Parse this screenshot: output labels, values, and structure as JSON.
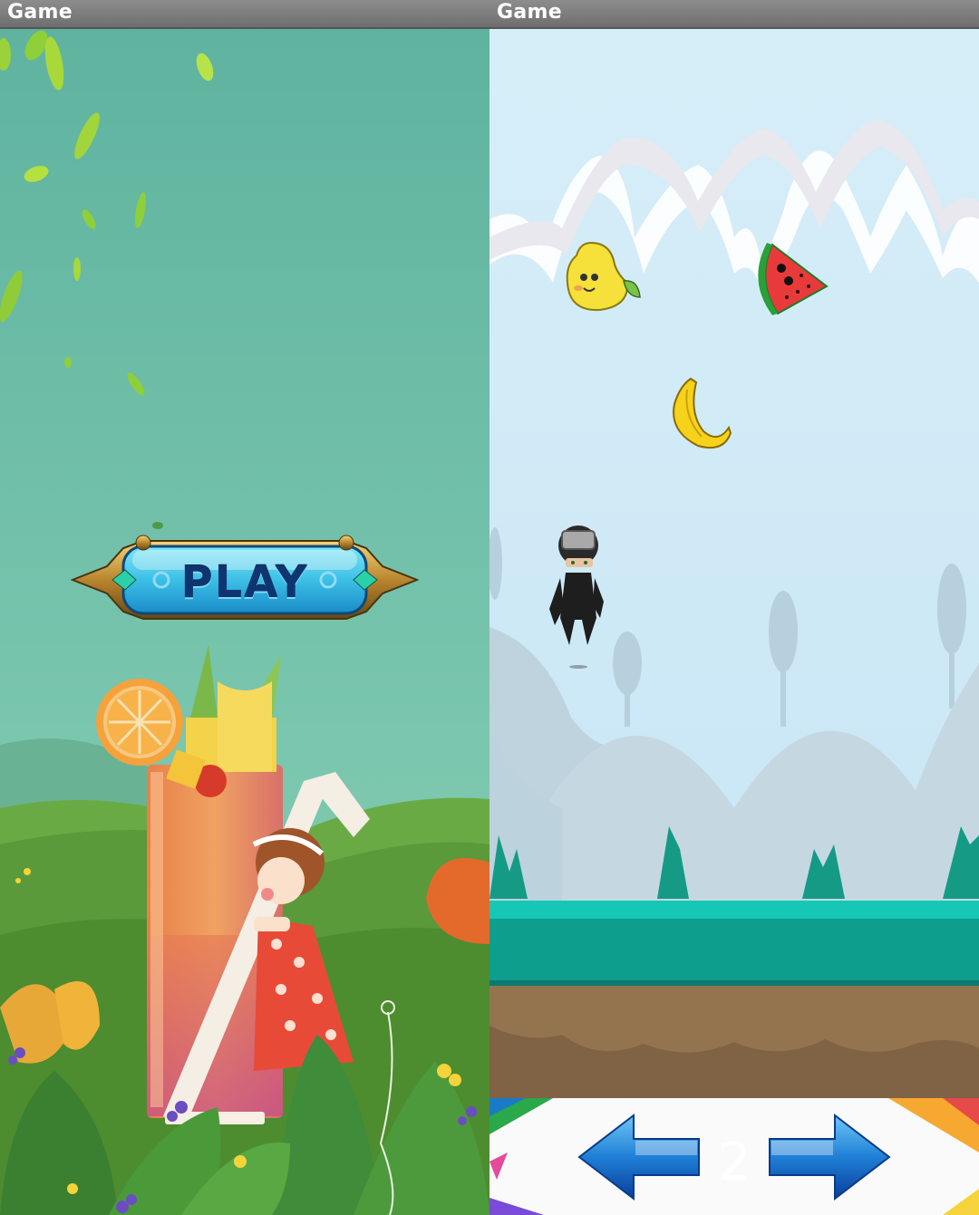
{
  "left_screen": {
    "window_title": "Game",
    "play_label": "PLAY"
  },
  "right_screen": {
    "window_title": "Game",
    "score": "2",
    "fruits": [
      "pear",
      "watermelon",
      "banana"
    ],
    "player": "ninja",
    "controls": [
      "left-arrow",
      "right-arrow"
    ]
  },
  "colors": {
    "title_bar": "#7a7a7a",
    "left_sky": "#6fbfa8",
    "right_sky": "#cfe9f5",
    "ground_grass": "#10a898",
    "ground_dirt": "#94744e",
    "arrow_blue": "#1f7fd6"
  }
}
